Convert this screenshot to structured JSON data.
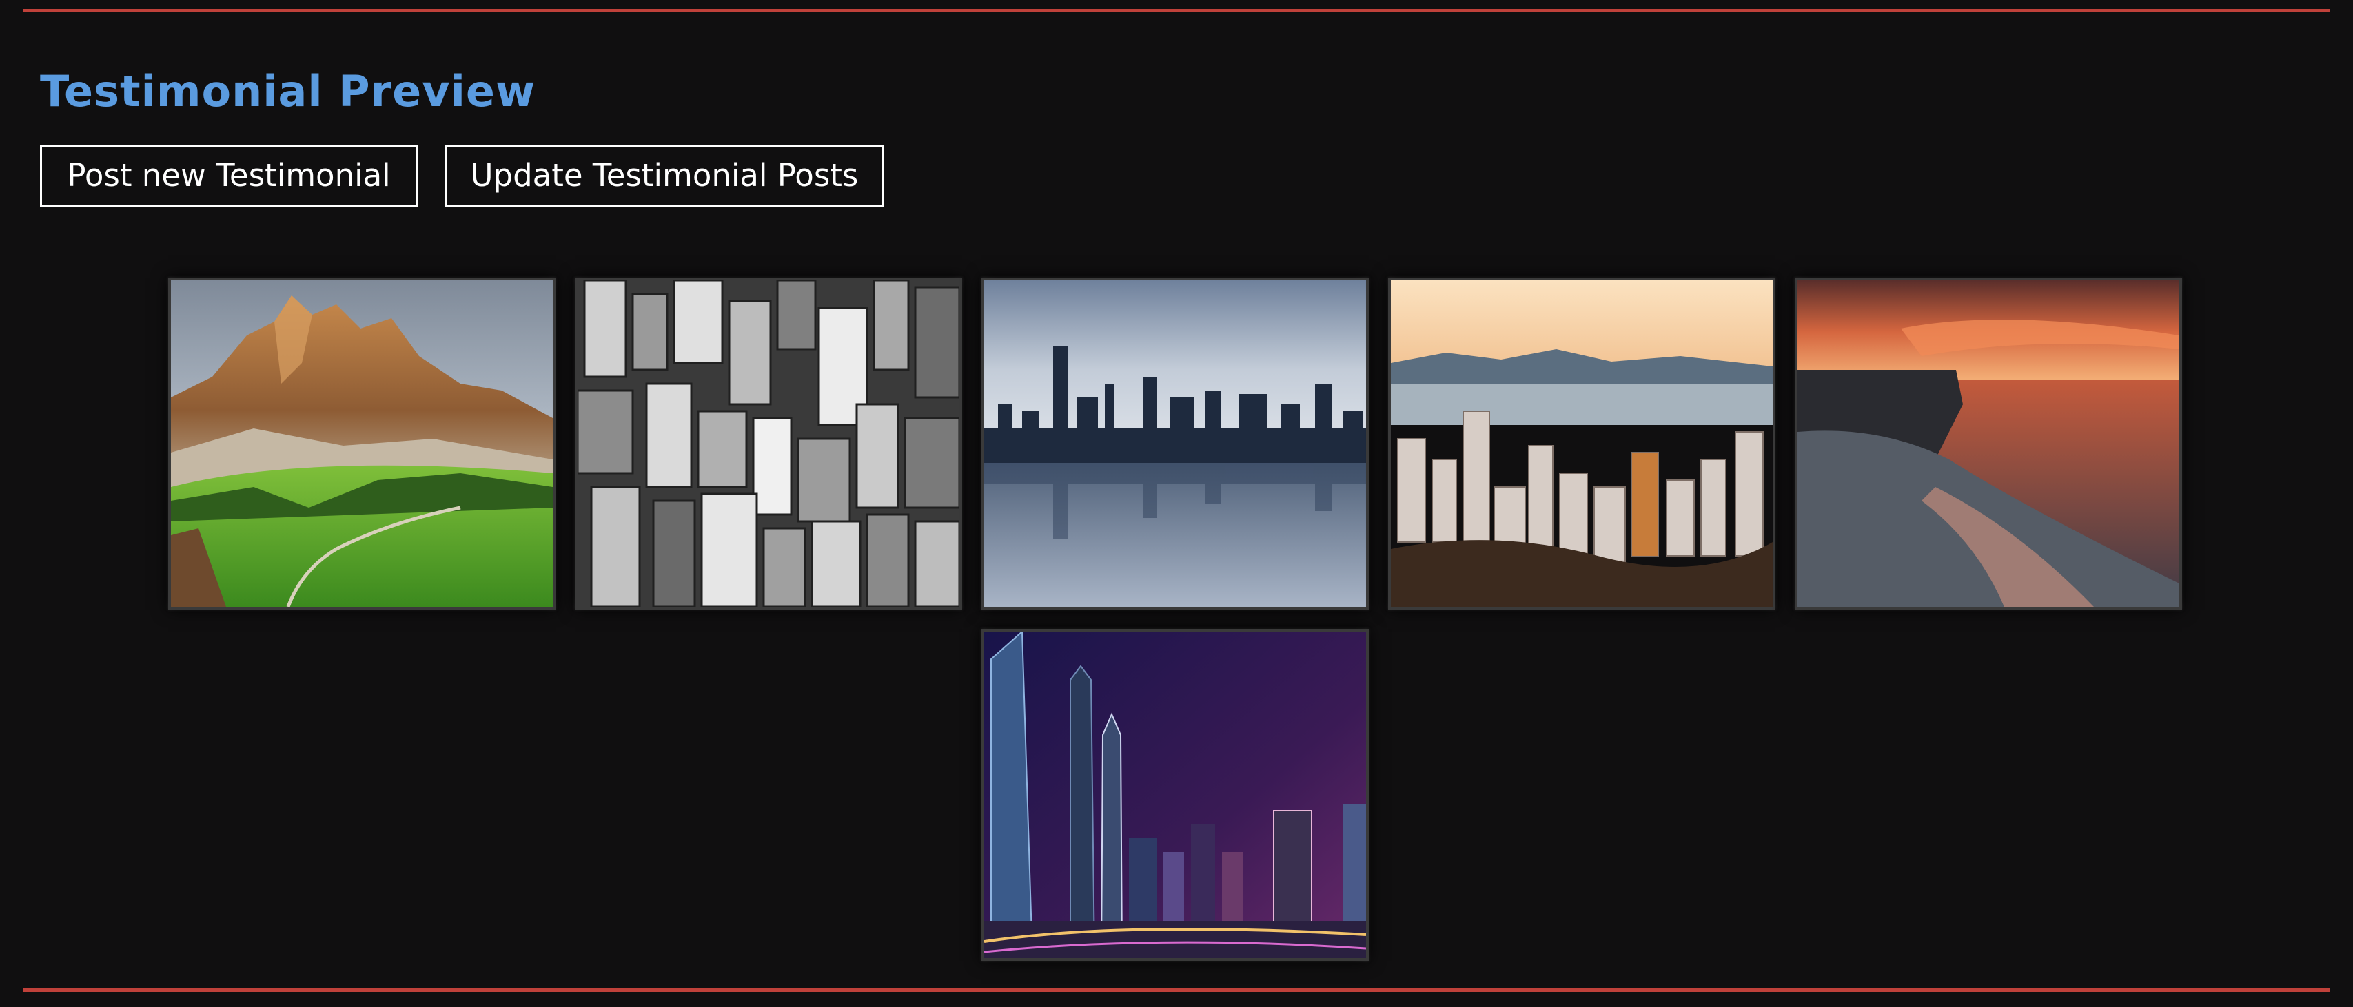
{
  "theme": {
    "background": "#100f10",
    "rule_color": "#c0413a",
    "title_color": "#5a9be0",
    "button_border": "#ffffff",
    "button_text": "#ffffff"
  },
  "page": {
    "title": "Testimonial Preview"
  },
  "actions": {
    "post_label": "Post new Testimonial",
    "update_label": "Update Testimonial Posts"
  },
  "gallery": {
    "images": [
      {
        "subject": "mountain-meadow"
      },
      {
        "subject": "city-aerial-bw"
      },
      {
        "subject": "skyline-reflection"
      },
      {
        "subject": "hong-kong-harbour"
      },
      {
        "subject": "sunset-sea-cliff"
      },
      {
        "subject": "shanghai-night"
      }
    ]
  }
}
